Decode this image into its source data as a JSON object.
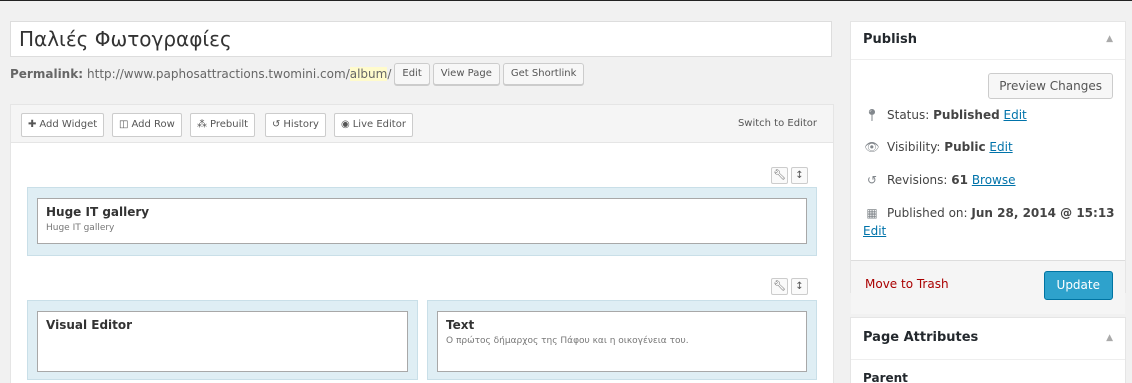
{
  "post": {
    "title": "Παλιές Φωτογραφίες",
    "permalink_label": "Permalink:",
    "permalink_base": "http://www.paphosattractions.twomini.com/",
    "permalink_slug": "album",
    "permalink_trail": "/",
    "edit_label": "Edit",
    "view_page_label": "View Page",
    "shortlink_label": "Get Shortlink"
  },
  "builder": {
    "toolbar": {
      "add_widget": "Add Widget",
      "add_row": "Add Row",
      "prebuilt": "Prebuilt",
      "history": "History",
      "live_editor": "Live Editor",
      "switch_editor": "Switch to Editor"
    },
    "rows": [
      {
        "widgets": [
          {
            "title": "Huge IT gallery",
            "desc": "Huge IT gallery"
          }
        ]
      },
      {
        "widgets": [
          {
            "title": "Visual Editor",
            "desc": ""
          },
          {
            "title": "Text",
            "desc": "Ο πρώτος δήμαρχος της Πάφου και η οικογένεια του."
          }
        ]
      }
    ]
  },
  "publish": {
    "title": "Publish",
    "preview_label": "Preview Changes",
    "status_label": "Status:",
    "status_value": "Published",
    "status_edit": "Edit",
    "visibility_label": "Visibility:",
    "visibility_value": "Public",
    "visibility_edit": "Edit",
    "revisions_label": "Revisions:",
    "revisions_value": "61",
    "revisions_browse": "Browse",
    "published_label": "Published on:",
    "published_value": "Jun 28, 2014 @ 15:13",
    "published_edit": "Edit",
    "trash_label": "Move to Trash",
    "update_label": "Update"
  },
  "page_attributes": {
    "title": "Page Attributes",
    "parent_label": "Parent"
  },
  "icons": {
    "status": "pin-icon",
    "visibility": "eye-icon",
    "revisions": "history-icon",
    "published": "calendar-icon"
  },
  "colors": {
    "accent": "#0073aa",
    "update_button": "#2ea2cc",
    "trash": "#aa0000",
    "cell_bg": "#dfeef4"
  }
}
